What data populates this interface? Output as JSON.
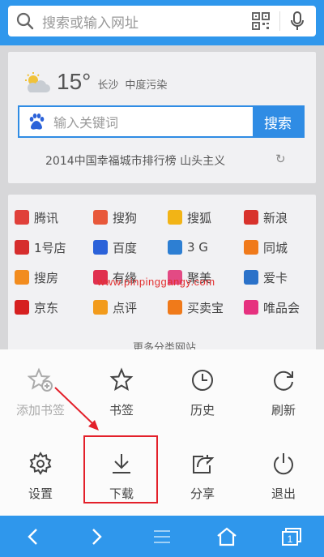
{
  "search": {
    "placeholder": "搜索或输入网址"
  },
  "weather": {
    "temp": "15°",
    "city": "长沙",
    "air": "中度污染"
  },
  "baidu": {
    "placeholder": "输入关键词",
    "button": "搜索"
  },
  "hot": {
    "text": "2014中国幸福城市排行榜 山头主义"
  },
  "sites": [
    {
      "label": "腾讯",
      "icon": "tencent-icon",
      "color": "#e0403a"
    },
    {
      "label": "搜狗",
      "icon": "sogou-icon",
      "color": "#e8583a"
    },
    {
      "label": "搜狐",
      "icon": "sohu-icon",
      "color": "#f2b416"
    },
    {
      "label": "新浪",
      "icon": "sina-icon",
      "color": "#d8322c"
    },
    {
      "label": "1号店",
      "icon": "yhd-icon",
      "color": "#d62d2d"
    },
    {
      "label": "百度",
      "icon": "baidu-icon",
      "color": "#2b62d9"
    },
    {
      "label": "3 G",
      "icon": "3g-icon",
      "color": "#2d7fd3"
    },
    {
      "label": "同城",
      "icon": "58-icon",
      "color": "#f07a1a"
    },
    {
      "label": "搜房",
      "icon": "soufun-icon",
      "color": "#f28c1e"
    },
    {
      "label": "有缘",
      "icon": "youyuan-icon",
      "color": "#e0304f"
    },
    {
      "label": "聚美",
      "icon": "jumei-icon",
      "color": "#e34a84"
    },
    {
      "label": "爱卡",
      "icon": "aika-icon",
      "color": "#2b72c9"
    },
    {
      "label": "京东",
      "icon": "jd-icon",
      "color": "#d62020"
    },
    {
      "label": "点评",
      "icon": "dianping-icon",
      "color": "#f29b1c"
    },
    {
      "label": "买卖宝",
      "icon": "maimaibao-icon",
      "color": "#f07a1a"
    },
    {
      "label": "唯品会",
      "icon": "vip-icon",
      "color": "#e6317f"
    }
  ],
  "more": "更多分类网站",
  "watermark": "www.pinpinggangy.com",
  "menu": [
    {
      "label": "添加书签",
      "icon": "add-bookmark-icon",
      "enabled": false
    },
    {
      "label": "书签",
      "icon": "bookmark-star-icon",
      "enabled": true
    },
    {
      "label": "历史",
      "icon": "history-clock-icon",
      "enabled": true
    },
    {
      "label": "刷新",
      "icon": "refresh-icon",
      "enabled": true
    },
    {
      "label": "设置",
      "icon": "settings-gear-icon",
      "enabled": true
    },
    {
      "label": "下载",
      "icon": "download-icon",
      "enabled": true
    },
    {
      "label": "分享",
      "icon": "share-icon",
      "enabled": true
    },
    {
      "label": "退出",
      "icon": "power-icon",
      "enabled": true
    }
  ],
  "bottom_nav": [
    "back-icon",
    "forward-icon",
    "menu-icon",
    "home-icon",
    "tabs-icon"
  ],
  "tabs_count": "1",
  "colors": {
    "brand": "#2f97ec",
    "highlight": "#e3202a"
  }
}
